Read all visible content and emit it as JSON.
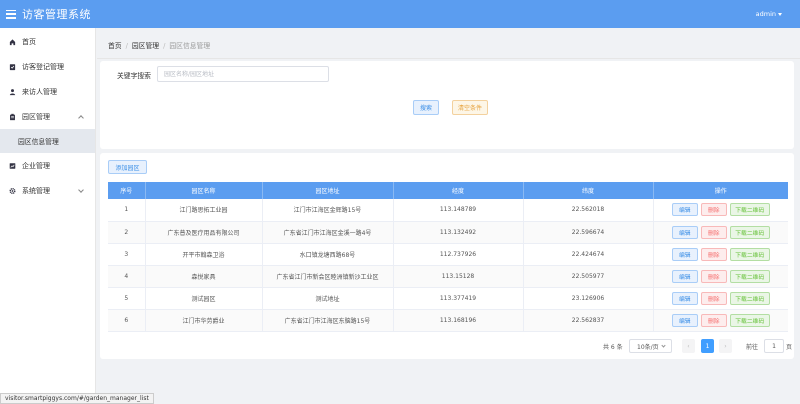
{
  "app": {
    "title": "访客管理系统",
    "user": "admin"
  },
  "sidebar": {
    "items": [
      {
        "label": "首页"
      },
      {
        "label": "访客登记管理"
      },
      {
        "label": "来访人管理"
      },
      {
        "label": "园区管理"
      },
      {
        "label": "园区信息管理"
      },
      {
        "label": "企业管理"
      },
      {
        "label": "系统管理"
      }
    ]
  },
  "breadcrumb": {
    "home": "首页",
    "parent": "园区管理",
    "current": "园区信息管理",
    "separator": "/"
  },
  "search": {
    "label": "关键字搜索",
    "placeholder": "园区名称/园区地址",
    "value": "",
    "search_button": "搜索",
    "reset_button": "清空条件"
  },
  "toolbar": {
    "add_button": "添加园区"
  },
  "table": {
    "headers": [
      "序号",
      "园区名称",
      "园区地址",
      "经度",
      "纬度",
      "操作"
    ],
    "rows": [
      {
        "no": "1",
        "name": "江门路思拓工业园",
        "address": "江门市江海区金辉路15号",
        "lng": "113.148789",
        "lat": "22.562018"
      },
      {
        "no": "2",
        "name": "广东普及医疗用品有限公司",
        "address": "广东省江门市江海区金溪一路4号",
        "lng": "113.132492",
        "lat": "22.596674"
      },
      {
        "no": "3",
        "name": "开平市翰森卫浴",
        "address": "水口镇龙塘西路68号",
        "lng": "112.737926",
        "lat": "22.424674"
      },
      {
        "no": "4",
        "name": "森悦家具",
        "address": "广东省江门市新会区睦洲镇新沙工业区",
        "lng": "113.15128",
        "lat": "22.505977"
      },
      {
        "no": "5",
        "name": "测试园区",
        "address": "测试地址",
        "lng": "113.377419",
        "lat": "23.126906"
      },
      {
        "no": "6",
        "name": "江门市华劳爵业",
        "address": "广东省江门市江海区东脑路15号",
        "lng": "113.168196",
        "lat": "22.562837"
      }
    ],
    "actions": {
      "edit": "编辑",
      "delete": "删除",
      "qrcode": "下载二维码"
    }
  },
  "pagination": {
    "total_text": "共 6 条",
    "page_size": "10条/页",
    "current_page": "1",
    "prev": "‹",
    "next": "›",
    "goto_label": "前往",
    "goto_value": "1",
    "page_suffix": "页"
  },
  "status_bar": {
    "url": "visitor.smartpiggys.com/#/garden_manager_list"
  },
  "icons": [
    "menu-icon",
    "home-icon",
    "register-icon",
    "visitor-icon",
    "park-icon",
    "company-icon",
    "settings-icon"
  ],
  "colors": {
    "header": "#5b9df0",
    "primary": "#409eff",
    "danger": "#f56c6c",
    "success": "#67c23a",
    "warning": "#e6a23c"
  }
}
